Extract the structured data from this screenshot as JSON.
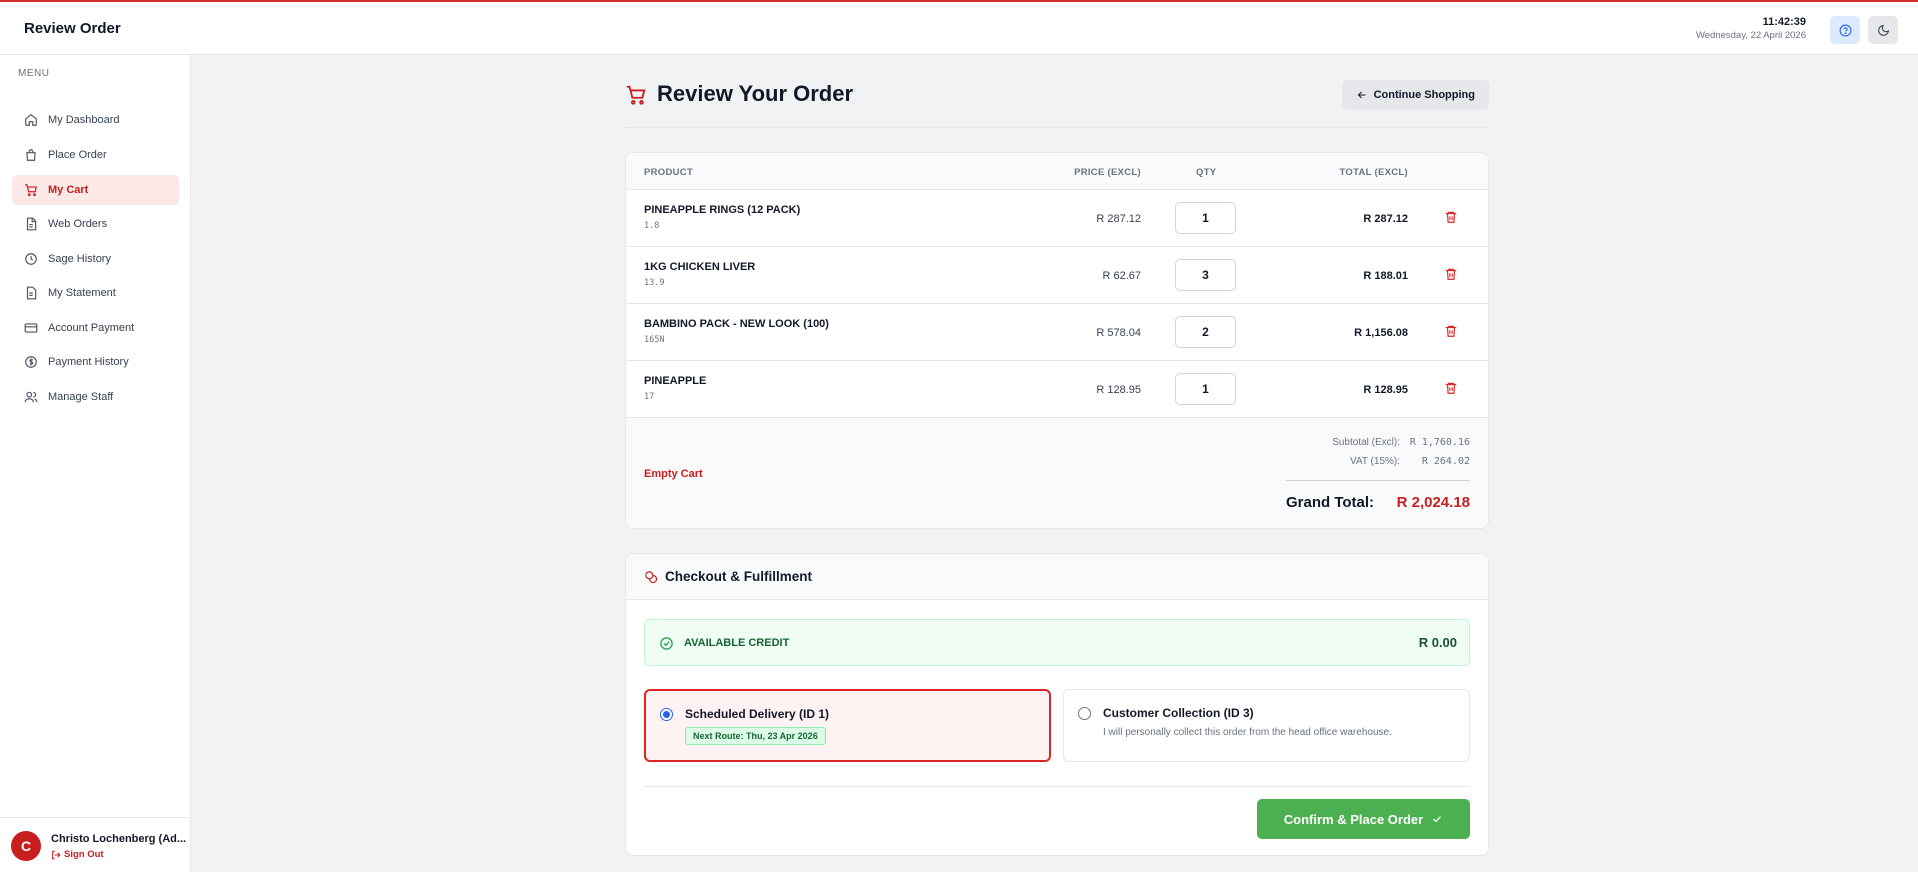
{
  "header": {
    "title": "Review Order",
    "time": "11:42:39",
    "date": "Wednesday, 22 April 2026",
    "help_icon": "help-circle-icon",
    "theme_icon": "moon-icon"
  },
  "sidebar": {
    "menu_heading": "MENU",
    "items": [
      {
        "label": "My Dashboard",
        "icon": "home-icon"
      },
      {
        "label": "Place Order",
        "icon": "shopping-bag-icon"
      },
      {
        "label": "My Cart",
        "icon": "cart-icon",
        "active": true
      },
      {
        "label": "Web Orders",
        "icon": "file-icon"
      },
      {
        "label": "Sage History",
        "icon": "clock-icon"
      },
      {
        "label": "My Statement",
        "icon": "document-icon"
      },
      {
        "label": "Account Payment",
        "icon": "credit-card-icon"
      },
      {
        "label": "Payment History",
        "icon": "dollar-circle-icon"
      },
      {
        "label": "Manage Staff",
        "icon": "users-icon"
      }
    ],
    "user": {
      "initial": "C",
      "name": "Christo Lochenberg (Ad...",
      "sign_out": "Sign Out"
    }
  },
  "main": {
    "title": "Review Your Order",
    "continue_label": "Continue Shopping",
    "table": {
      "headers": {
        "product": "PRODUCT",
        "price": "PRICE (EXCL)",
        "qty": "QTY",
        "total": "TOTAL (EXCL)"
      },
      "rows": [
        {
          "name": "PINEAPPLE RINGS (12 PACK)",
          "code": "1.8",
          "price": "R 287.12",
          "qty": "1",
          "total": "R 287.12"
        },
        {
          "name": "1KG CHICKEN LIVER",
          "code": "13.9",
          "price": "R 62.67",
          "qty": "3",
          "total": "R 188.01"
        },
        {
          "name": "BAMBINO PACK - NEW LOOK (100)",
          "code": "165N",
          "price": "R 578.04",
          "qty": "2",
          "total": "R 1,156.08"
        },
        {
          "name": "PINEAPPLE",
          "code": "17",
          "price": "R 128.95",
          "qty": "1",
          "total": "R 128.95"
        }
      ]
    },
    "summary": {
      "empty_cart": "Empty Cart",
      "subtotal_label": "Subtotal (Excl):",
      "subtotal_value": "R 1,760.16",
      "vat_label": "VAT (15%):",
      "vat_value": "R 264.02",
      "grand_label": "Grand Total:",
      "grand_value": "R 2,024.18"
    },
    "checkout": {
      "title": "Checkout & Fulfillment",
      "credit_label": "AVAILABLE CREDIT",
      "credit_value": "R 0.00",
      "options": [
        {
          "title": "Scheduled Delivery (ID 1)",
          "badge": "Next Route: Thu, 23 Apr 2026",
          "selected": true
        },
        {
          "title": "Customer Collection (ID 3)",
          "description": "I will personally collect this order from the head office warehouse.",
          "selected": false
        }
      ],
      "confirm_label": "Confirm & Place Order"
    }
  },
  "colors": {
    "accent": "#c81e1e",
    "success": "#4caf50",
    "selected_radio": "#2563eb"
  }
}
